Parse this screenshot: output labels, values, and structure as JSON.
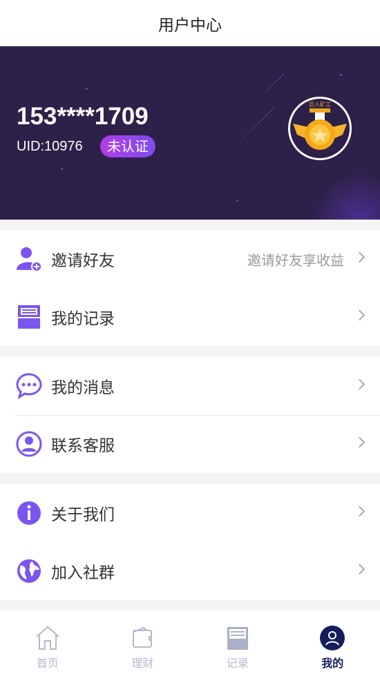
{
  "header": {
    "title": "用户中心"
  },
  "profile": {
    "phone": "153****1709",
    "uid": "UID:10976",
    "verify_status": "未认证",
    "medal_text": "巨人矿工"
  },
  "groups": [
    [
      {
        "icon": "add-user-icon",
        "label": "邀请好友",
        "sub": "邀请好友享收益"
      },
      {
        "icon": "record-icon",
        "label": "我的记录"
      }
    ],
    [
      {
        "icon": "message-icon",
        "label": "我的消息"
      },
      {
        "icon": "customer-service-icon",
        "label": "联系客服"
      }
    ],
    [
      {
        "icon": "info-icon",
        "label": "关于我们"
      },
      {
        "icon": "globe-icon",
        "label": "加入社群"
      }
    ]
  ],
  "tabbar": [
    {
      "icon": "home-icon",
      "label": "首页"
    },
    {
      "icon": "wallet-icon",
      "label": "理财"
    },
    {
      "icon": "record-icon",
      "label": "记录"
    },
    {
      "icon": "user-icon",
      "label": "我的",
      "active": true
    }
  ],
  "colors": {
    "accent": "#7a55f0",
    "banner": "#2d2049",
    "tab_active": "#151d5c"
  }
}
